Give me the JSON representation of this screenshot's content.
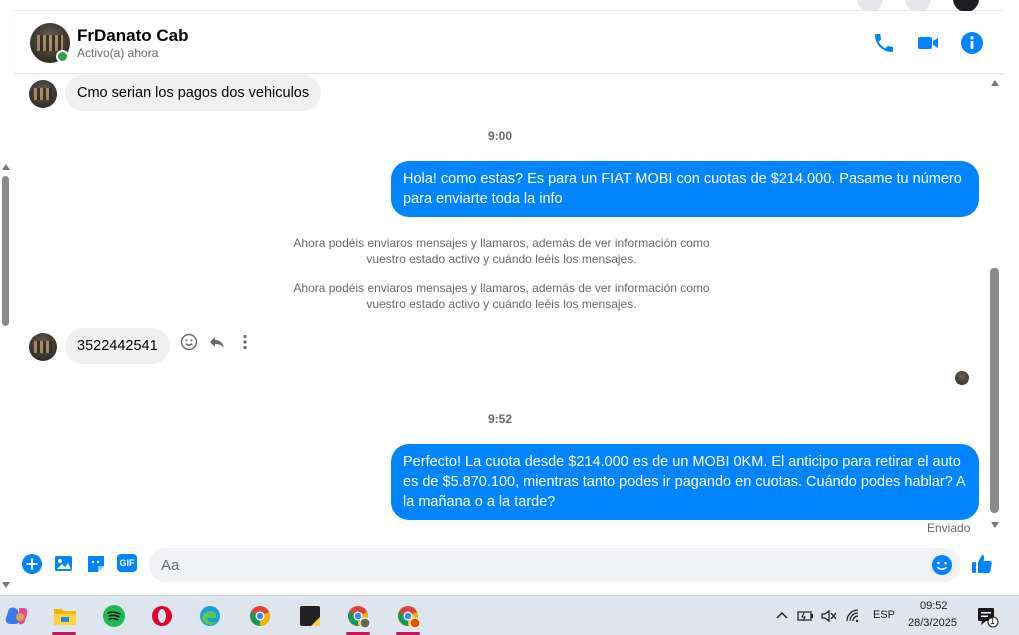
{
  "contact": {
    "name": "FrDanato Cab",
    "status": "Activo(a) ahora"
  },
  "header_actions": [
    {
      "icon": "phone-icon"
    },
    {
      "icon": "video-icon"
    },
    {
      "icon": "info-icon"
    }
  ],
  "messages": {
    "m1": "Cmo serian los pagos dos vehiculos",
    "t1": "9:00",
    "m2": "Hola! como estas? Es para un FIAT MOBI con cuotas de $214.000. Pasame tu número para enviarte toda la info",
    "n1_line1": "Ahora podéis enviaros mensajes y llamaros, además de ver información como",
    "n1_line2": "vuestro estado activo y cuándo leéis los mensajes.",
    "n2_line1": "Ahora podéis enviaros mensajes y llamaros, además de ver información como",
    "n2_line2": "vuestro estado activo y cuándo leéis los mensajes.",
    "m3": "3522442541",
    "t2": "9:52",
    "m4": "Perfecto! La cuota desde $214.000 es de un MOBI 0KM. El anticipo para retirar el auto es de $5.870.100, mientras tanto podes ir pagando en cuotas. Cuándo podes hablar? A la mañana o a la tarde?",
    "sent_status": "Enviado"
  },
  "composer": {
    "placeholder": "Aa",
    "gif_label": "GIF"
  },
  "colors": {
    "accent": "#0084ff",
    "incoming_bubble": "#f0f0f0",
    "online": "#31a24c"
  },
  "taskbar": {
    "apps": [
      "copilot-icon",
      "file-explorer-icon",
      "spotify-icon",
      "opera-icon",
      "edge-icon",
      "chrome-icon",
      "sticky-notes-icon",
      "chrome-profile-icon",
      "chrome-profile-2-icon"
    ],
    "language": "ESP",
    "time": "09:52",
    "date": "28/3/2025",
    "notification_count": "1"
  }
}
